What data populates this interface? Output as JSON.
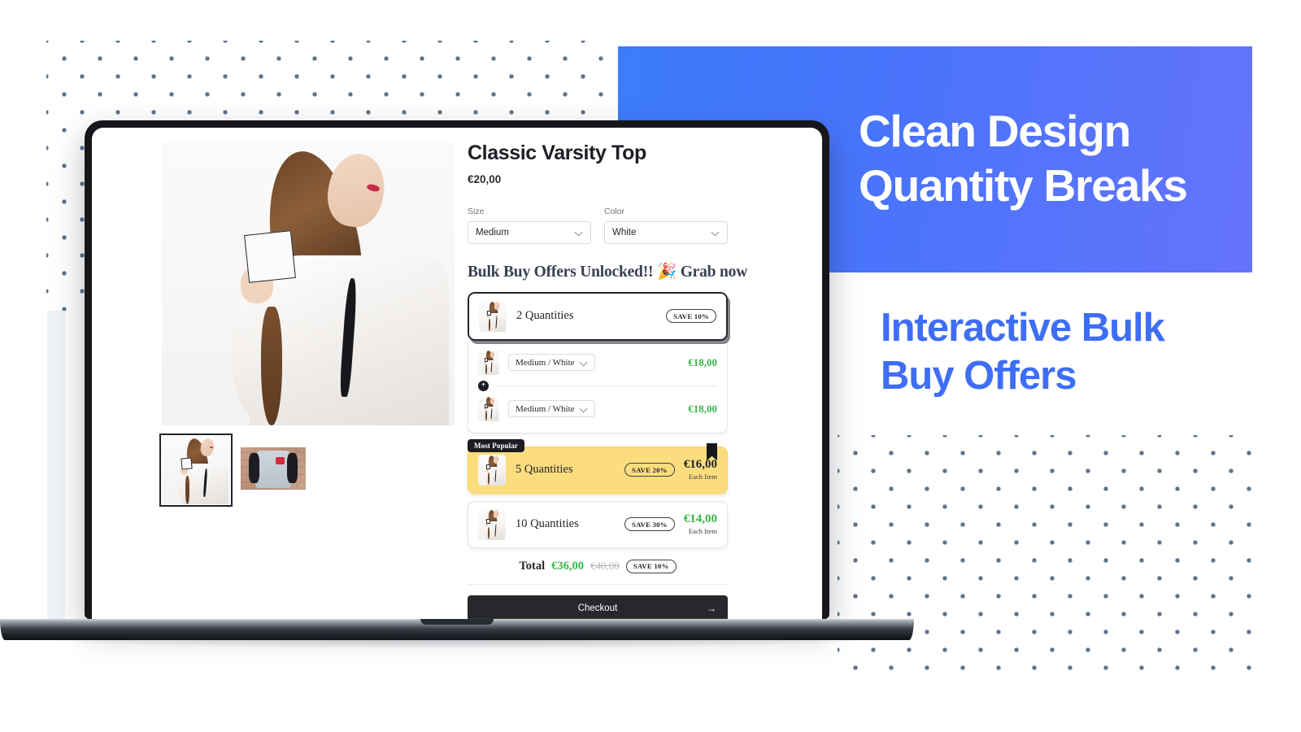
{
  "promo": {
    "headline_white": "Clean Design Quantity Breaks",
    "headline_blue": "Interactive Bulk Buy Offers",
    "blue_accent": "#3f6ef5",
    "gradient_from": "#3c7cfb",
    "gradient_to": "#6573fb"
  },
  "product": {
    "title": "Classic Varsity Top",
    "price": "€20,00",
    "options": [
      {
        "label": "Size",
        "value": "Medium"
      },
      {
        "label": "Color",
        "value": "White"
      }
    ]
  },
  "bulk": {
    "heading": "Bulk Buy Offers Unlocked!! 🎉 Grab now",
    "tiers": [
      {
        "qty_label": "2 Quantities",
        "save": "SAVE 10%",
        "price": "",
        "each": "",
        "selected": true,
        "popular": false,
        "badge": ""
      },
      {
        "qty_label": "5 Quantities",
        "save": "SAVE 20%",
        "price": "€16,00",
        "each": "Each Item",
        "selected": false,
        "popular": true,
        "badge": "Most Popular"
      },
      {
        "qty_label": "10 Quantities",
        "save": "SAVE 30%",
        "price": "€14,00",
        "each": "Each Item",
        "selected": false,
        "popular": false,
        "badge": ""
      }
    ],
    "variant_rows": [
      {
        "variant": "Medium / White",
        "price": "€18,00"
      },
      {
        "variant": "Medium / White",
        "price": "€18,00"
      }
    ],
    "add_icon": "+",
    "total": {
      "label": "Total",
      "now": "€36,00",
      "was": "€40,00",
      "save": "SAVE 10%"
    },
    "price_color": "#3ab54a",
    "highlight_color": "#fcdd7d"
  },
  "checkout": {
    "label": "Checkout",
    "arrow": "→"
  }
}
